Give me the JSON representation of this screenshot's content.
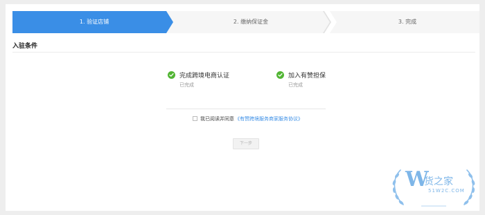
{
  "steps": [
    {
      "label": "1. 验证店铺",
      "active": true
    },
    {
      "label": "2. 缴纳保证金",
      "active": false
    },
    {
      "label": "3. 完成",
      "active": false
    }
  ],
  "section": {
    "title": "入驻条件"
  },
  "conditions": [
    {
      "label": "完成跨境电商认证",
      "status": "已完成",
      "icon": "check-circle-icon"
    },
    {
      "label": "加入有赞担保",
      "status": "已完成",
      "icon": "check-circle-icon"
    }
  ],
  "agreement": {
    "text": "我已阅读并同意",
    "link": "《有赞跨境服务商家服务协议》",
    "checked": false
  },
  "next_button": {
    "label": "下一步",
    "disabled": true
  },
  "watermark": {
    "logo": "W",
    "name": "货之家",
    "site": "51W2C.COM"
  },
  "colors": {
    "accent": "#3a8ee6",
    "success": "#52b534",
    "muted": "#999999"
  }
}
